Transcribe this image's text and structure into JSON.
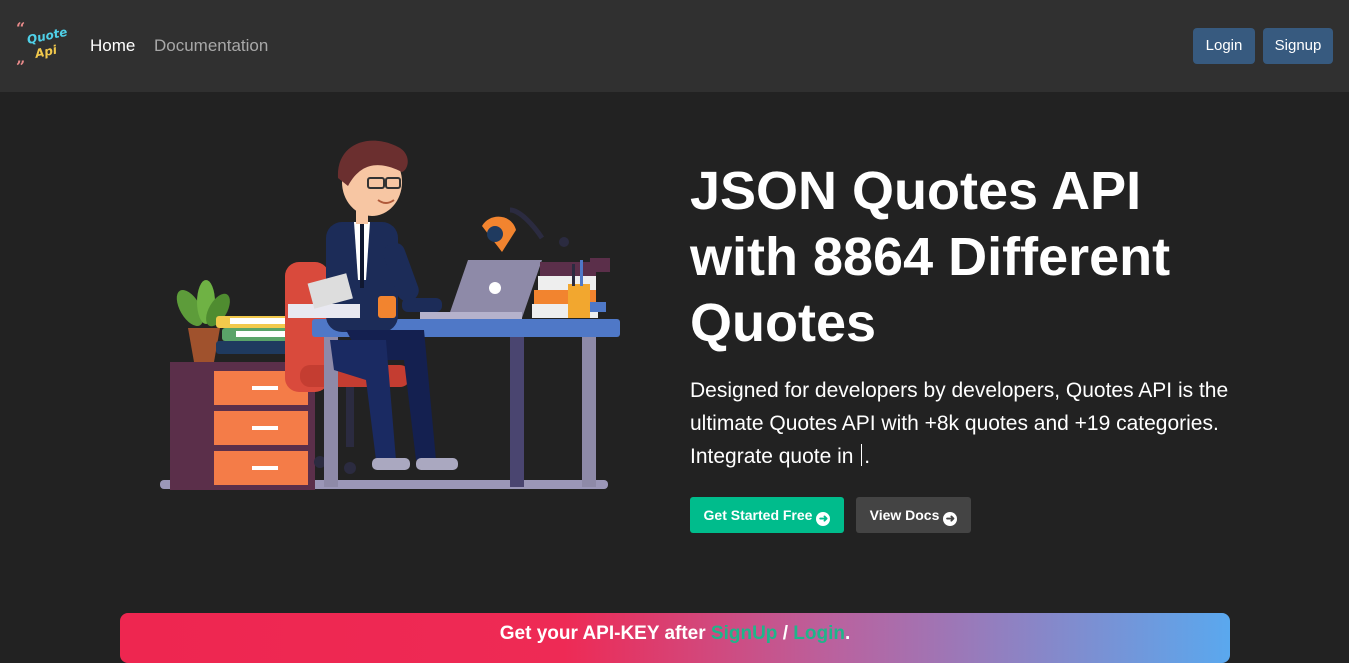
{
  "nav": {
    "logo_text": "Quotes Api",
    "links": [
      {
        "label": "Home",
        "active": true
      },
      {
        "label": "Documentation",
        "active": false
      }
    ],
    "login_label": "Login",
    "signup_label": "Signup"
  },
  "hero": {
    "title_lines": [
      "JSON Quotes API",
      "with 8864 Different",
      "Quotes"
    ],
    "description_before_cursor": "Designed for developers by developers, Quotes API is the ultimate Quotes API with +8k quotes and +19 categories. Integrate quote in ",
    "description_after_cursor": ".",
    "get_started_label": "Get Started Free",
    "view_docs_label": "View Docs",
    "button_icon": "arrow-circle-right-icon"
  },
  "banner": {
    "prefix": "Get your API-KEY after ",
    "signup_link": "SignUp",
    "separator": " / ",
    "login_link": "Login",
    "suffix": "."
  },
  "colors": {
    "background": "#222222",
    "navbar": "#303030",
    "nav_button": "#375a7f",
    "primary_cta": "#00bc8c",
    "secondary_cta": "#444444",
    "banner_start": "#ee2650",
    "banner_end": "#5aa8ee",
    "banner_link": "#1fb58a"
  }
}
